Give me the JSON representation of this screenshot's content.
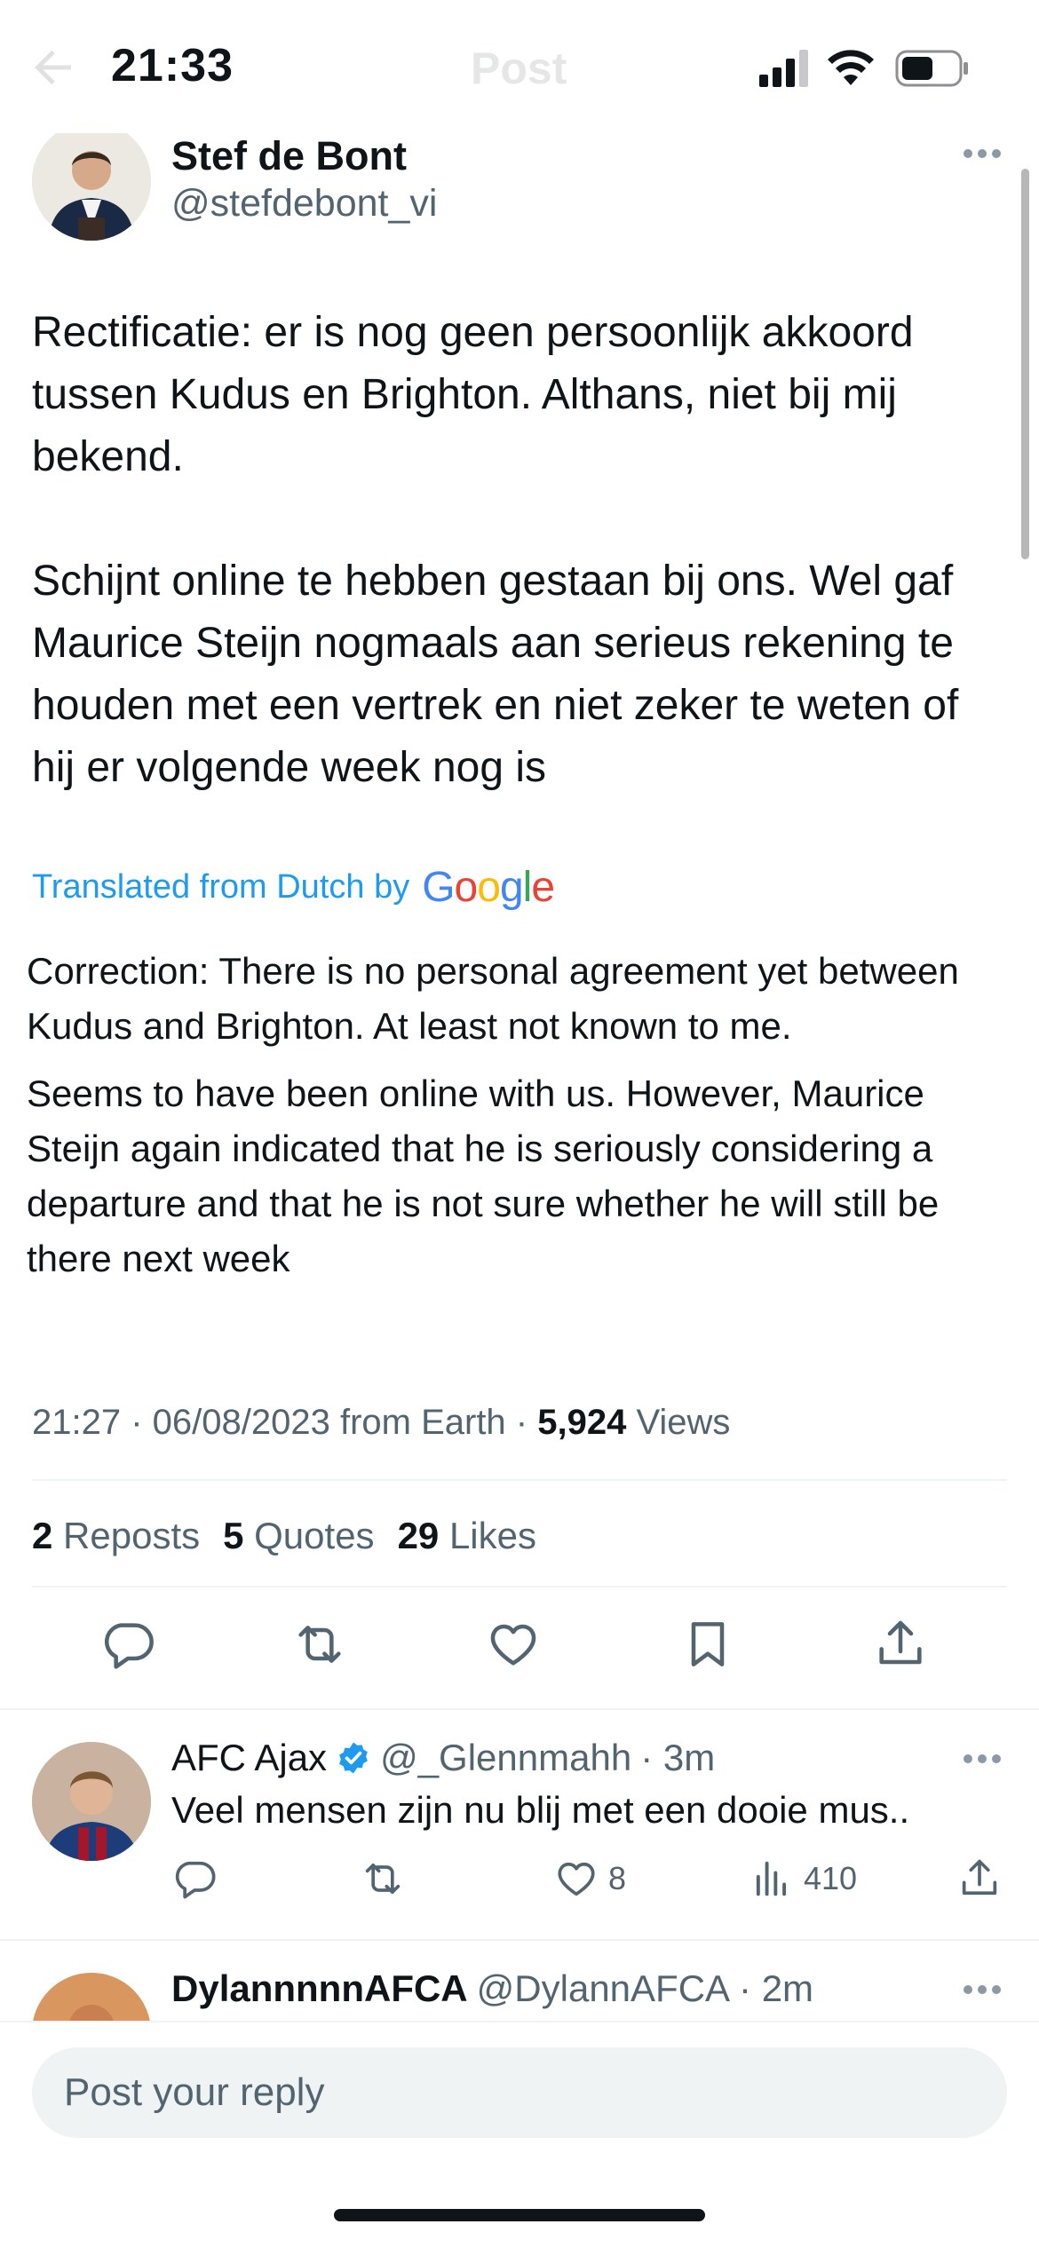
{
  "status_bar": {
    "time": "21:33"
  },
  "nav": {
    "title": "Post"
  },
  "tweet": {
    "author_name": "Stef de Bont",
    "author_handle": "@stefdebont_vi",
    "text_paragraphs": [
      "Rectificatie: er is nog geen persoonlijk akkoord tussen Kudus en Brighton. Althans, niet bij mij bekend.",
      "Schijnt online te hebben gestaan bij ons. Wel gaf Maurice Steijn nogmaals aan serieus rekening te houden met een vertrek en niet zeker te weten of hij er volgende week nog is"
    ],
    "translated_label": "Translated from Dutch by",
    "translation_provider": "Google",
    "translation_paragraphs": [
      "Correction: There is no personal agreement yet between Kudus and Brighton. At least not known to me.",
      "Seems to have been online with us. However, Maurice Steijn again indicated that he is seriously considering a departure and that he is not sure whether he will still be there next week"
    ],
    "timestamp": "21:27 · 06/08/2023 from Earth · ",
    "views_count": "5,924",
    "views_label": " Views",
    "stats": {
      "reposts_count": "2",
      "reposts_label": "Reposts",
      "quotes_count": "5",
      "quotes_label": "Quotes",
      "likes_count": "29",
      "likes_label": "Likes"
    }
  },
  "replies": [
    {
      "name": "AFC Ajax",
      "verified": true,
      "handle": "@_Glennmahh",
      "time": "· 3m",
      "text": "Veel mensen zijn nu blij met een dooie mus..",
      "likes": "8",
      "views": "410"
    },
    {
      "name": "DylannnnnAFCA",
      "verified": false,
      "handle": "@DylannAFCA",
      "time": "· 2m"
    }
  ],
  "reply_bar": {
    "placeholder": "Post your reply"
  },
  "colors": {
    "accent": "#1d9bf0",
    "text": "#0f1419",
    "secondary": "#536471",
    "divider": "#eff3f4"
  }
}
